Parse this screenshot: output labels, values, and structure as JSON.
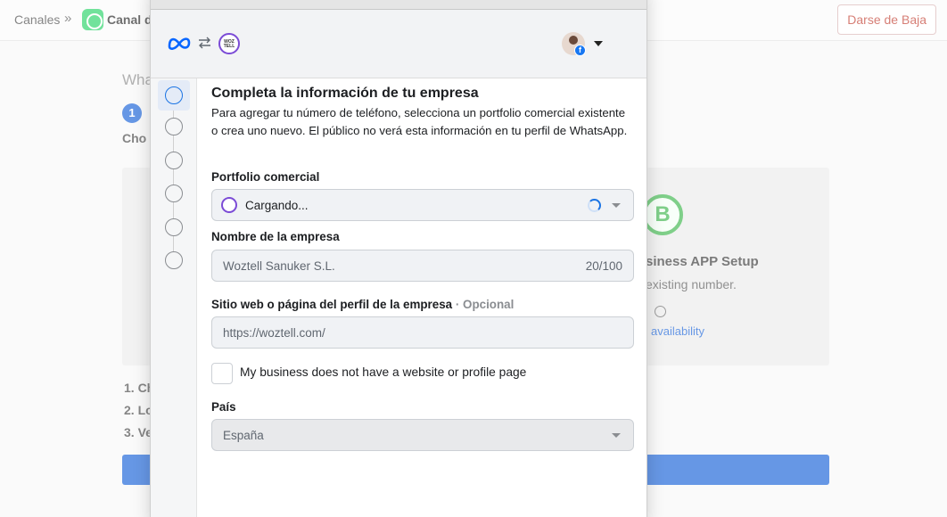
{
  "background": {
    "breadcrumb": {
      "root": "Canales",
      "separator": "»",
      "current": "Canal d"
    },
    "unsubscribe_label": "Darse de Baja",
    "heading": "Wha",
    "step_number": "1",
    "step_text": "Cho",
    "card": {
      "badge_letter": "B",
      "title": "siness APP Setup",
      "subtitle": "existing number.",
      "link": "availability"
    },
    "list": [
      "1. Ch",
      "2. Lo",
      "3. Ve"
    ],
    "colors": {
      "primary": "#1560d8",
      "whatsapp": "#25d366",
      "badge_green": "#3bb54a"
    }
  },
  "modal": {
    "header": {
      "icons": [
        "meta-logo-icon",
        "swap-arrows-icon",
        "woztell-logo-icon",
        "avatar",
        "facebook-badge-icon",
        "caret-down-icon"
      ],
      "fb_badge_letter": "f"
    },
    "steps": {
      "count": 6,
      "active_index": 0
    },
    "title": "Completa la información de tu empresa",
    "description": "Para agregar tu número de teléfono, selecciona un portfolio comercial existente o crea uno nuevo. El público no verá esta información en tu perfil de WhatsApp.",
    "portfolio": {
      "label": "Portfolio comercial",
      "value": "Cargando..."
    },
    "company_name": {
      "label": "Nombre de la empresa",
      "value": "Woztell Sanuker S.L.",
      "counter": "20/100"
    },
    "website": {
      "label": "Sitio web o página del perfil de la empresa",
      "optional": " · Opcional",
      "placeholder": "https://woztell.com/"
    },
    "no_website_checkbox": {
      "label": "My business does not have a website or profile page",
      "checked": false
    },
    "country": {
      "label": "País",
      "value": "España"
    },
    "colors": {
      "accent": "#1b74e4",
      "woztell": "#7b4bd6"
    }
  }
}
